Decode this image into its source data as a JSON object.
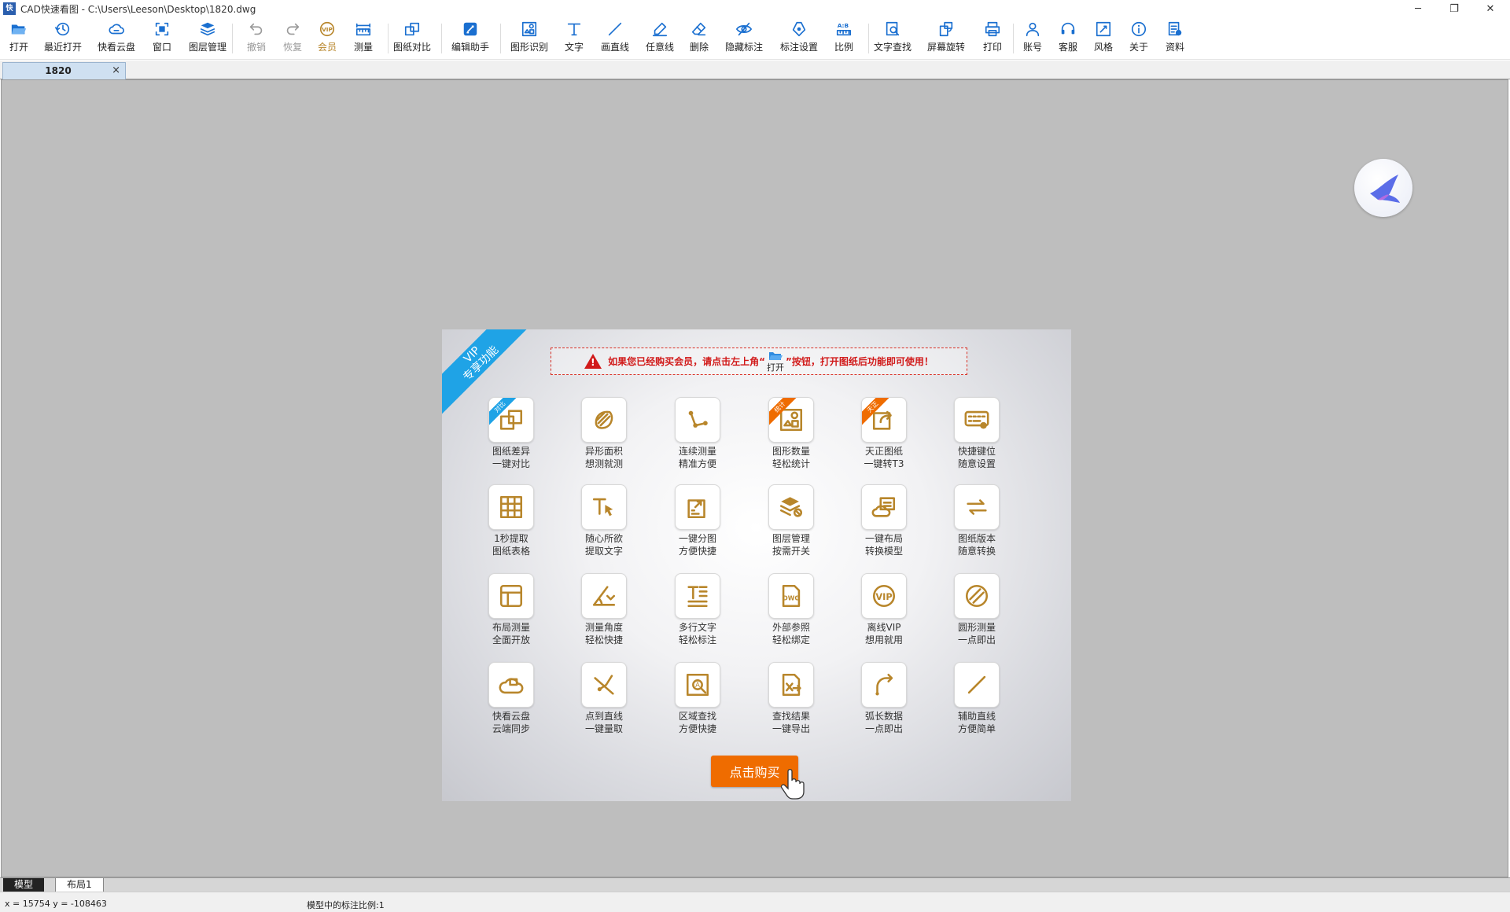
{
  "window": {
    "title": "CAD快速看图 - C:\\Users\\Leeson\\Desktop\\1820.dwg",
    "app_icon_text": "快",
    "controls": [
      "minimize",
      "restore",
      "close"
    ]
  },
  "toolbar": {
    "buttons": [
      {
        "id": "open",
        "label": "打开",
        "icon": "folder-open-icon",
        "state": "normal"
      },
      {
        "id": "recent",
        "label": "最近打开",
        "icon": "history-icon",
        "state": "normal"
      },
      {
        "id": "cloud",
        "label": "快看云盘",
        "icon": "cloud-icon",
        "state": "normal"
      },
      {
        "id": "window",
        "label": "窗口",
        "icon": "window-fit-icon",
        "state": "normal"
      },
      {
        "id": "layers",
        "label": "图层管理",
        "icon": "layers-icon",
        "state": "normal"
      },
      {
        "id": "undo",
        "label": "撤销",
        "icon": "undo-icon",
        "state": "disabled"
      },
      {
        "id": "redo",
        "label": "恢复",
        "icon": "redo-icon",
        "state": "disabled"
      },
      {
        "id": "vip",
        "label": "会员",
        "icon": "vip-icon",
        "state": "vip"
      },
      {
        "id": "measure",
        "label": "测量",
        "icon": "ruler-icon",
        "state": "normal"
      },
      {
        "id": "compare",
        "label": "图纸对比",
        "icon": "compare-icon",
        "state": "normal"
      },
      {
        "id": "edit",
        "label": "编辑助手",
        "icon": "edit-assistant-icon",
        "state": "normal"
      },
      {
        "id": "recognize",
        "label": "图形识别",
        "icon": "shape-recognize-icon",
        "state": "normal"
      },
      {
        "id": "text",
        "label": "文字",
        "icon": "text-icon",
        "state": "normal"
      },
      {
        "id": "line",
        "label": "画直线",
        "icon": "line-icon",
        "state": "normal"
      },
      {
        "id": "freeline",
        "label": "任意线",
        "icon": "pen-icon",
        "state": "normal"
      },
      {
        "id": "delete",
        "label": "删除",
        "icon": "eraser-icon",
        "state": "normal"
      },
      {
        "id": "hide",
        "label": "隐藏标注",
        "icon": "eye-hide-icon",
        "state": "normal"
      },
      {
        "id": "annot",
        "label": "标注设置",
        "icon": "annotation-settings-icon",
        "state": "normal"
      },
      {
        "id": "scale",
        "label": "比例",
        "icon": "scale-icon",
        "state": "normal"
      },
      {
        "id": "find",
        "label": "文字查找",
        "icon": "text-search-icon",
        "state": "normal"
      },
      {
        "id": "rotate",
        "label": "屏幕旋转",
        "icon": "rotate-screen-icon",
        "state": "normal"
      },
      {
        "id": "print",
        "label": "打印",
        "icon": "printer-icon",
        "state": "normal"
      },
      {
        "id": "account",
        "label": "账号",
        "icon": "user-icon",
        "state": "normal"
      },
      {
        "id": "service",
        "label": "客服",
        "icon": "headset-icon",
        "state": "normal"
      },
      {
        "id": "style",
        "label": "风格",
        "icon": "style-icon",
        "state": "normal"
      },
      {
        "id": "about",
        "label": "关于",
        "icon": "info-icon",
        "state": "normal"
      },
      {
        "id": "docs",
        "label": "资料",
        "icon": "docs-icon",
        "state": "normal"
      }
    ]
  },
  "tabs": {
    "document": "1820",
    "close": "×"
  },
  "vip_panel": {
    "ribbon": "VIP\n专享功能",
    "notice": {
      "prefix": "如果您已经购买会员，请点击左上角“",
      "open_label": "打开",
      "suffix": "”按钮，打开图纸后功能即可使用！"
    },
    "features": [
      {
        "l1": "图纸差异",
        "l2": "一键对比",
        "tag": "对比",
        "tag_color": "#1fa3e6",
        "icon": "compare-icon"
      },
      {
        "l1": "异形面积",
        "l2": "想测就测",
        "tag": "",
        "icon": "irregular-area-icon"
      },
      {
        "l1": "连续测量",
        "l2": "精准方便",
        "tag": "",
        "icon": "continuous-measure-icon"
      },
      {
        "l1": "图形数量",
        "l2": "轻松统计",
        "tag": "统计",
        "tag_color": "#ef6c00",
        "icon": "shape-count-icon"
      },
      {
        "l1": "天正图纸",
        "l2": "一键转T3",
        "tag": "天正",
        "tag_color": "#ef6c00",
        "icon": "export-icon"
      },
      {
        "l1": "快捷键位",
        "l2": "随意设置",
        "tag": "",
        "icon": "keyboard-icon"
      },
      {
        "l1": "1秒提取",
        "l2": "图纸表格",
        "tag": "",
        "icon": "table-grid-icon"
      },
      {
        "l1": "随心所欲",
        "l2": "提取文字",
        "tag": "",
        "icon": "text-cursor-icon"
      },
      {
        "l1": "一键分图",
        "l2": "方便快捷",
        "tag": "",
        "icon": "split-drawing-icon"
      },
      {
        "l1": "图层管理",
        "l2": "按需开关",
        "tag": "",
        "icon": "layers-off-icon"
      },
      {
        "l1": "一键布局",
        "l2": "转换模型",
        "tag": "",
        "icon": "cloud-layout-icon"
      },
      {
        "l1": "图纸版本",
        "l2": "随意转换",
        "tag": "",
        "icon": "swap-icon"
      },
      {
        "l1": "布局测量",
        "l2": "全面开放",
        "tag": "",
        "icon": "layout-icon"
      },
      {
        "l1": "测量角度",
        "l2": "轻松快捷",
        "tag": "",
        "icon": "angle-icon"
      },
      {
        "l1": "多行文字",
        "l2": "轻松标注",
        "tag": "",
        "icon": "multiline-text-icon"
      },
      {
        "l1": "外部参照",
        "l2": "轻松绑定",
        "tag": "",
        "icon": "dwg-file-icon"
      },
      {
        "l1": "离线VIP",
        "l2": "想用就用",
        "tag": "",
        "icon": "vip-icon"
      },
      {
        "l1": "圆形测量",
        "l2": "一点即出",
        "tag": "",
        "icon": "circle-measure-icon"
      },
      {
        "l1": "快看云盘",
        "l2": "云端同步",
        "tag": "",
        "icon": "cloud-sync-icon"
      },
      {
        "l1": "点到直线",
        "l2": "一键量取",
        "tag": "",
        "icon": "point-to-line-icon"
      },
      {
        "l1": "区域查找",
        "l2": "方便快捷",
        "tag": "",
        "icon": "area-search-icon"
      },
      {
        "l1": "查找结果",
        "l2": "一键导出",
        "tag": "",
        "icon": "export-excel-icon"
      },
      {
        "l1": "弧长数据",
        "l2": "一点即出",
        "tag": "",
        "icon": "arc-length-icon"
      },
      {
        "l1": "辅助直线",
        "l2": "方便简单",
        "tag": "",
        "icon": "diagonal-line-icon"
      }
    ],
    "buy_button": "点击购买"
  },
  "layout_tabs": [
    "模型",
    "布局1"
  ],
  "status": {
    "coords": "x = 15754  y = -108463",
    "scale": "模型中的标注比例:1"
  },
  "colors": {
    "accent": "#1a6fd0",
    "vip_gold": "#b8862b",
    "buy": "#ef6c00",
    "ribbon": "#1fa3e6",
    "notice_red": "#d11a1a"
  }
}
